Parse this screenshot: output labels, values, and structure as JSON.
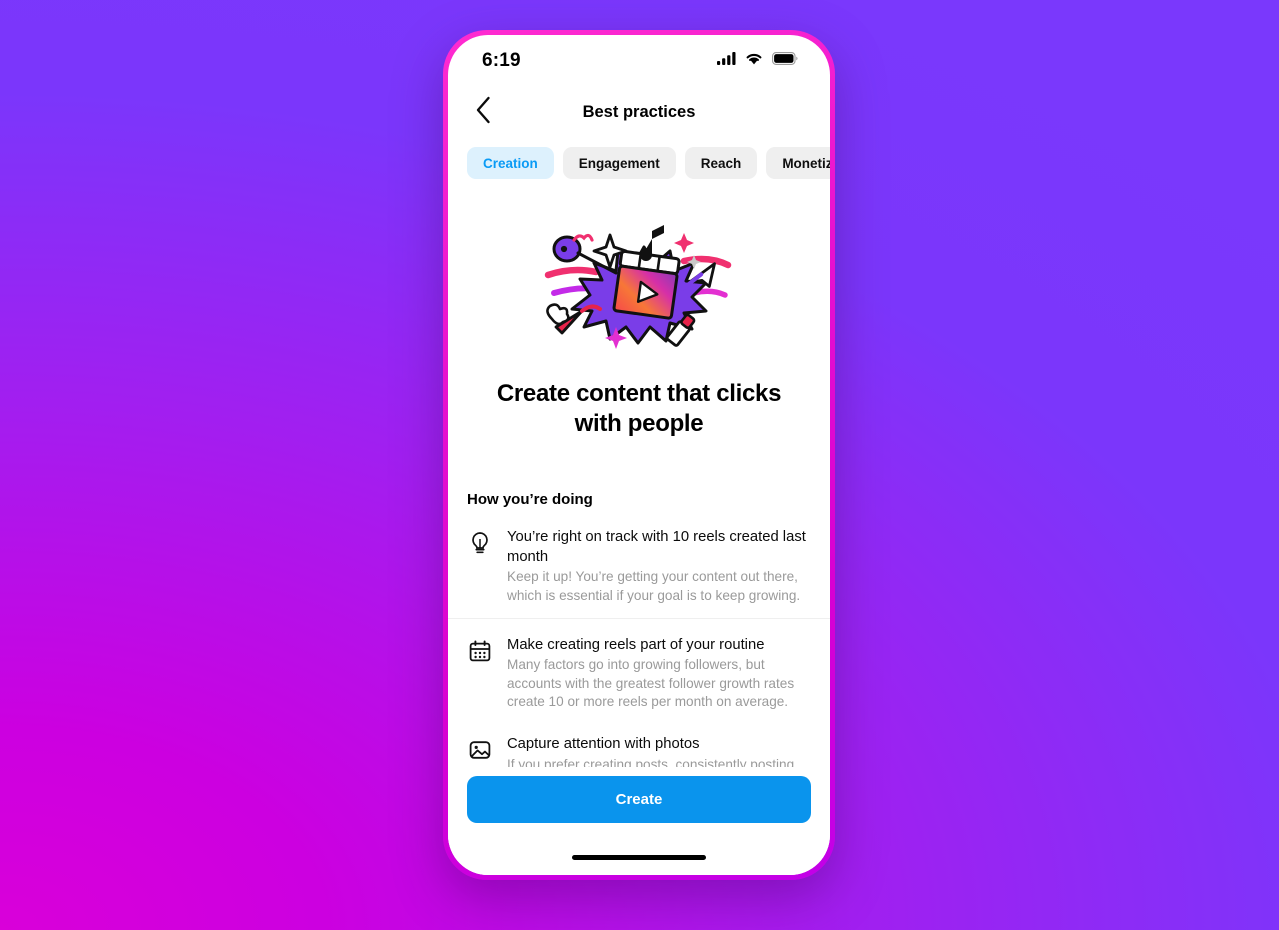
{
  "background": {
    "gradient_from": "#d900d9",
    "gradient_to": "#7a38fc"
  },
  "phone": {
    "frame_color": "#e812cf"
  },
  "status_bar": {
    "time": "6:19",
    "icons": [
      "cellular-signal-icon",
      "wifi-icon",
      "battery-icon"
    ]
  },
  "nav": {
    "back_icon": "chevron-left-icon",
    "title": "Best practices"
  },
  "tabs": {
    "selected_index": 0,
    "selected_bg": "#ddf1fd",
    "selected_color": "#0a9bf5",
    "items": [
      {
        "label": "Creation"
      },
      {
        "label": "Engagement"
      },
      {
        "label": "Reach"
      },
      {
        "label": "Monetization"
      }
    ]
  },
  "hero": {
    "illustration_name": "reels-creation-burst-illustration",
    "title": "Create content that clicks with people"
  },
  "section": {
    "heading": "How you’re doing",
    "tips": [
      {
        "icon": "lightbulb-icon",
        "title": "You’re right on track with 10 reels created last month",
        "desc": "Keep it up! You’re getting your content out there, which is essential if your goal is to keep growing."
      },
      {
        "icon": "calendar-icon",
        "title": "Make creating reels part of your routine",
        "desc": "Many factors go into growing followers, but accounts with the greatest follower growth rates create 10 or more reels per month on average."
      },
      {
        "icon": "photo-icon",
        "title": "Capture attention with photos",
        "desc": "If you prefer creating posts, consistently posting"
      }
    ]
  },
  "footer": {
    "create_label": "Create",
    "create_color": "#0a94ed",
    "home_indicator": "home-indicator"
  }
}
